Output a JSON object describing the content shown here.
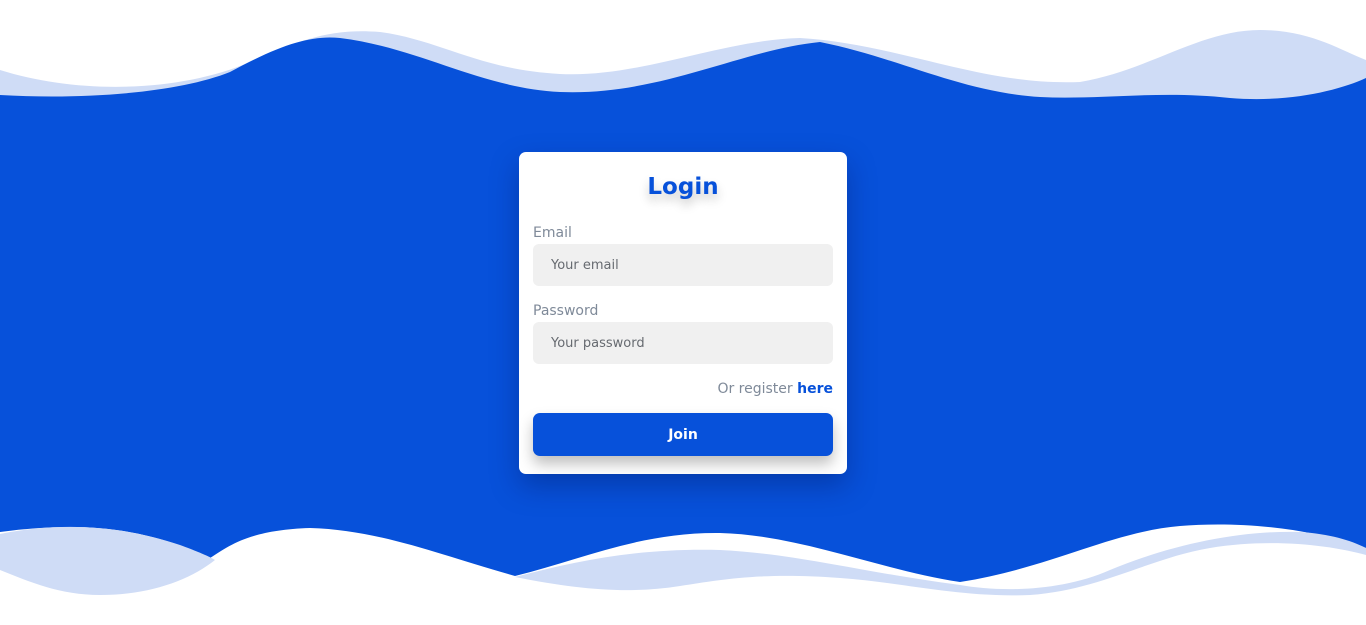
{
  "colors": {
    "accent": "#0751da",
    "wave_light": "#cfdcf6",
    "page_bg": "#ffffff"
  },
  "login": {
    "title": "Login",
    "email_label": "Email",
    "email_placeholder": "Your email",
    "email_value": "",
    "password_label": "Password",
    "password_placeholder": "Your password",
    "password_value": "",
    "register_prefix": "Or register",
    "register_link": "here",
    "join_label": "Join"
  }
}
